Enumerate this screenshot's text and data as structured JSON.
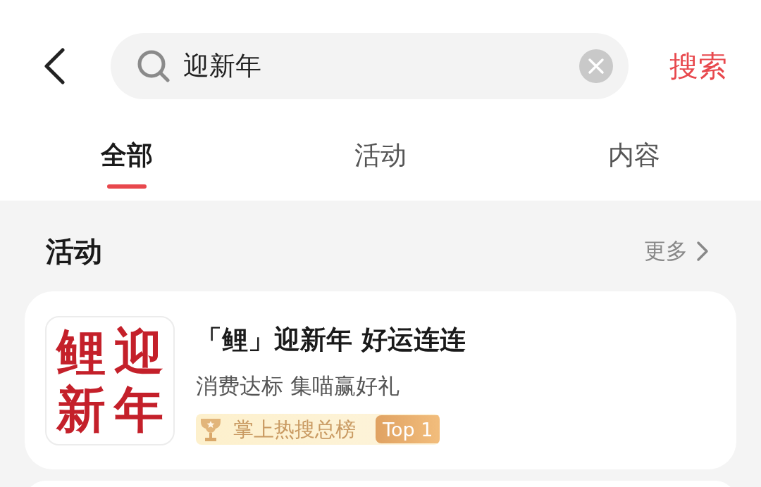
{
  "search": {
    "value": "迎新年",
    "action": "搜索"
  },
  "tabs": [
    {
      "label": "全部",
      "selected": true
    },
    {
      "label": "活动",
      "selected": false
    },
    {
      "label": "内容",
      "selected": false
    }
  ],
  "sections": [
    {
      "title": "活动",
      "more": "更多",
      "results": [
        {
          "thumbnail": [
            "鲤",
            "迎",
            "新",
            "年"
          ],
          "title": "「鲤」迎新年 好运连连",
          "subtitle": "消费达标 集喵赢好礼",
          "rank": {
            "label": "掌上热搜总榜",
            "badge": "Top 1"
          }
        }
      ]
    }
  ]
}
